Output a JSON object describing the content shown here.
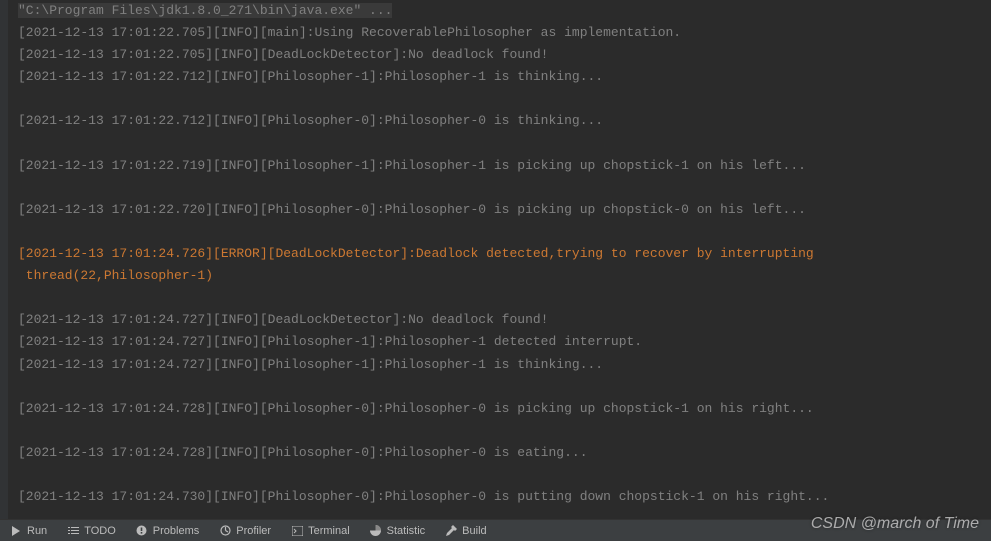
{
  "console": {
    "command": "\"C:\\Program Files\\jdk1.8.0_271\\bin\\java.exe\" ...",
    "lines": [
      {
        "text": "[2021-12-13 17:01:22.705][INFO][main]:Using RecoverablePhilosopher as implementation.",
        "type": "info"
      },
      {
        "text": "[2021-12-13 17:01:22.705][INFO][DeadLockDetector]:No deadlock found!",
        "type": "info"
      },
      {
        "text": "[2021-12-13 17:01:22.712][INFO][Philosopher-1]:Philosopher-1 is thinking...",
        "type": "info"
      },
      {
        "text": "",
        "type": "blank"
      },
      {
        "text": "[2021-12-13 17:01:22.712][INFO][Philosopher-0]:Philosopher-0 is thinking...",
        "type": "info"
      },
      {
        "text": "",
        "type": "blank"
      },
      {
        "text": "[2021-12-13 17:01:22.719][INFO][Philosopher-1]:Philosopher-1 is picking up chopstick-1 on his left...",
        "type": "info"
      },
      {
        "text": "",
        "type": "blank"
      },
      {
        "text": "[2021-12-13 17:01:22.720][INFO][Philosopher-0]:Philosopher-0 is picking up chopstick-0 on his left...",
        "type": "info"
      },
      {
        "text": "",
        "type": "blank"
      },
      {
        "text": "[2021-12-13 17:01:24.726][ERROR][DeadLockDetector]:Deadlock detected,trying to recover by interrupting",
        "type": "error"
      },
      {
        "text": " thread(22,Philosopher-1)",
        "type": "error"
      },
      {
        "text": "",
        "type": "blank"
      },
      {
        "text": "[2021-12-13 17:01:24.727][INFO][DeadLockDetector]:No deadlock found!",
        "type": "info"
      },
      {
        "text": "[2021-12-13 17:01:24.727][INFO][Philosopher-1]:Philosopher-1 detected interrupt.",
        "type": "info"
      },
      {
        "text": "[2021-12-13 17:01:24.727][INFO][Philosopher-1]:Philosopher-1 is thinking...",
        "type": "info"
      },
      {
        "text": "",
        "type": "blank"
      },
      {
        "text": "[2021-12-13 17:01:24.728][INFO][Philosopher-0]:Philosopher-0 is picking up chopstick-1 on his right...",
        "type": "info"
      },
      {
        "text": "",
        "type": "blank"
      },
      {
        "text": "[2021-12-13 17:01:24.728][INFO][Philosopher-0]:Philosopher-0 is eating...",
        "type": "info"
      },
      {
        "text": "",
        "type": "blank"
      },
      {
        "text": "[2021-12-13 17:01:24.730][INFO][Philosopher-0]:Philosopher-0 is putting down chopstick-1 on his right...",
        "type": "info"
      },
      {
        "text": "",
        "type": "blank"
      }
    ]
  },
  "tabs": {
    "run": "Run",
    "todo": "TODO",
    "problems": "Problems",
    "profiler": "Profiler",
    "terminal": "Terminal",
    "statistic": "Statistic",
    "build": "Build"
  },
  "watermark": "CSDN @march of Time"
}
